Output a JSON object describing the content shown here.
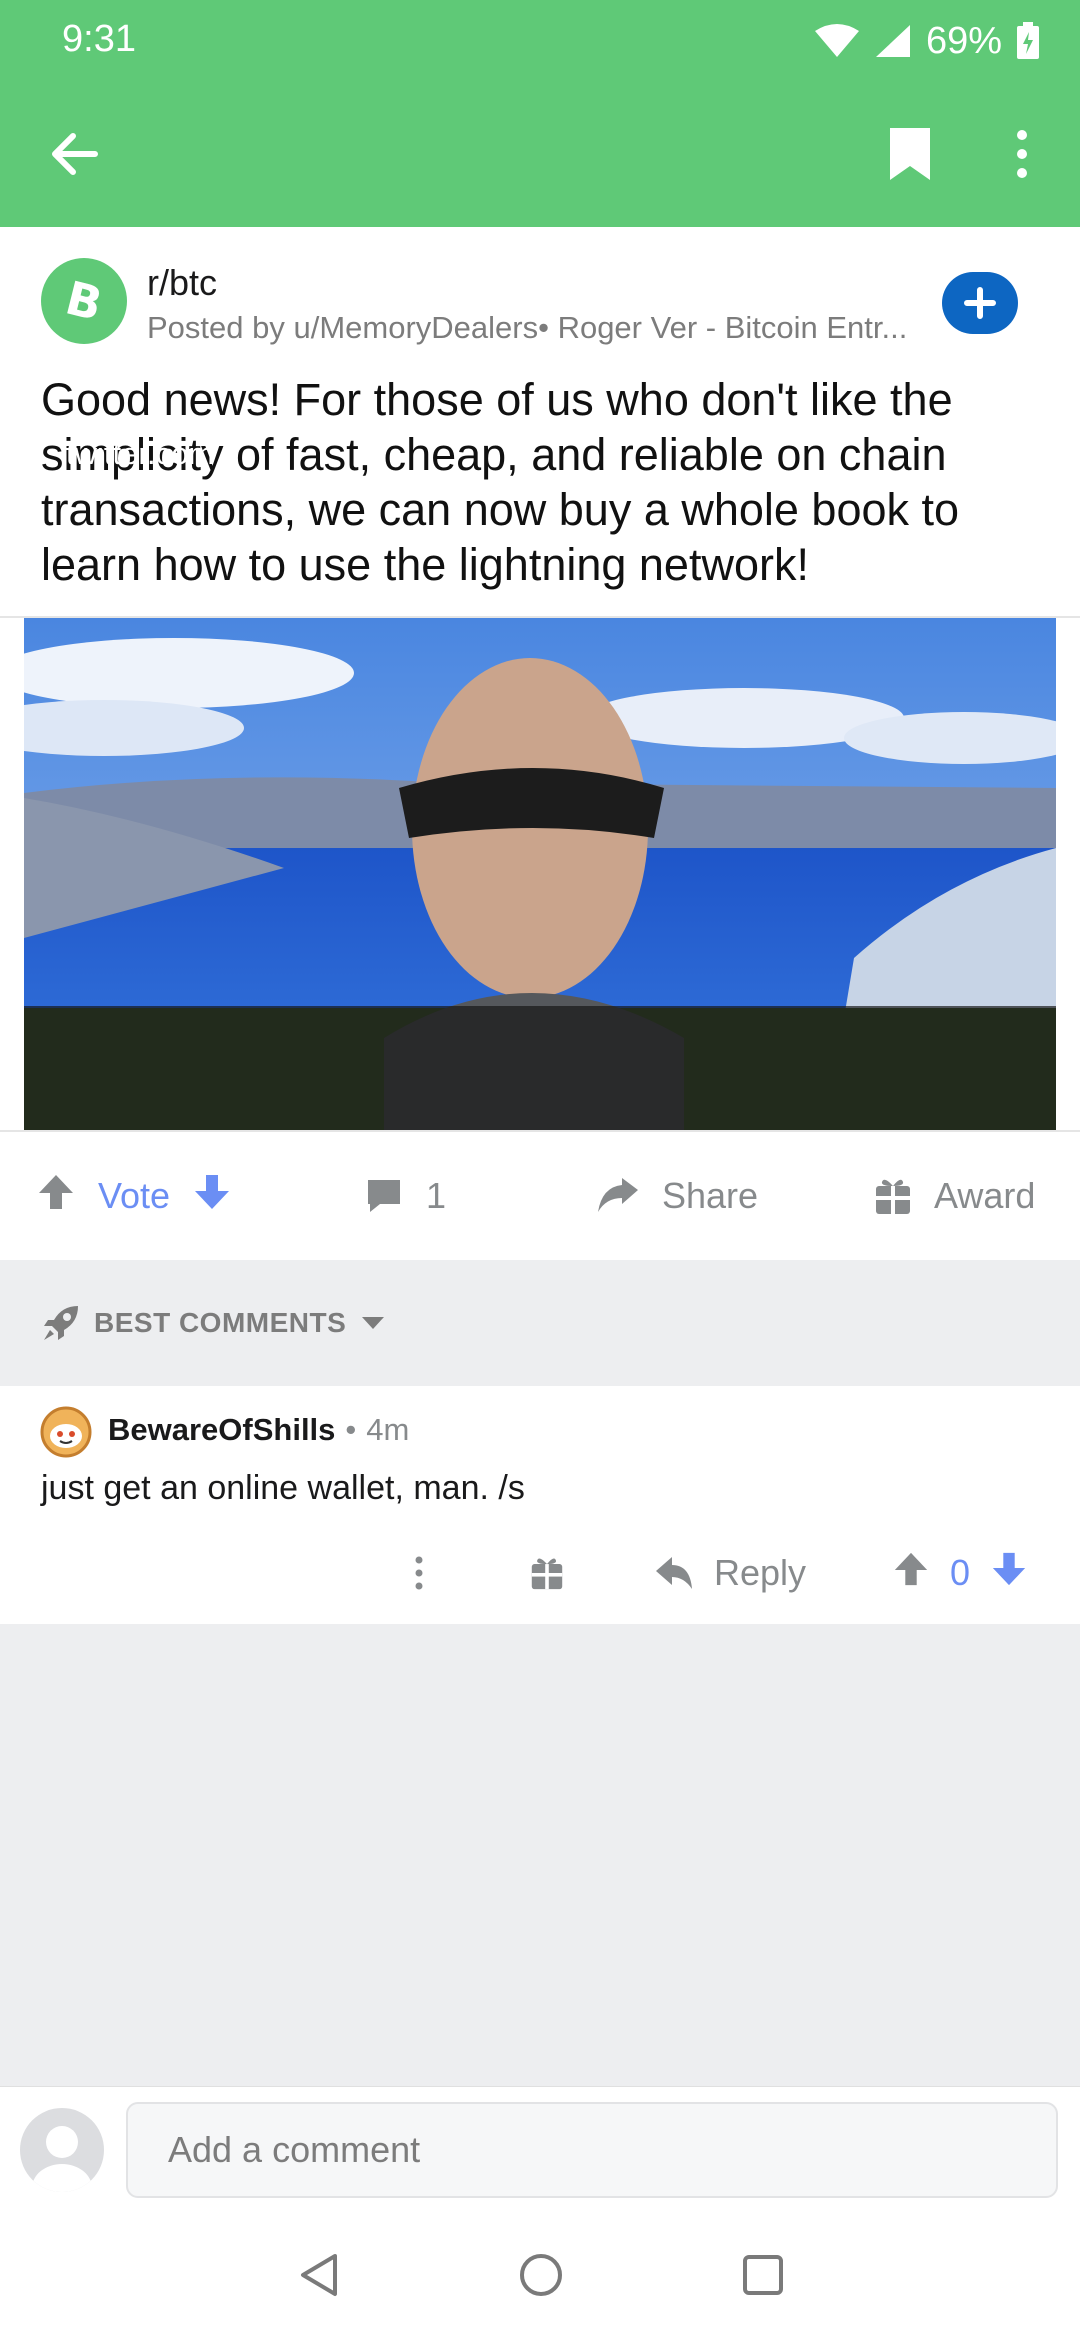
{
  "status_bar": {
    "time": "9:31",
    "battery": "69%"
  },
  "app_bar": {
    "back_icon": "arrow-left-icon",
    "bookmark_icon": "bookmark-icon",
    "more_icon": "more-vertical-icon"
  },
  "post": {
    "subreddit": "r/btc",
    "posted_by": "Posted by u/MemoryDealers• Roger Ver - Bitcoin Entr...",
    "title": "Good news! For those of us who don't like the simplicity of fast, cheap, and reliable on chain transactions, we can now buy a whole book to learn how to use the lightning network!",
    "link_domain": "twitter.com",
    "accent_color": "#5fc977",
    "join_color": "#0d66c2"
  },
  "actions": {
    "vote_label": "Vote",
    "comment_count": "1",
    "share_label": "Share",
    "award_label": "Award"
  },
  "sort": {
    "label": "BEST COMMENTS"
  },
  "comment": {
    "author": "BewareOfShills",
    "separator": "•",
    "age": "4m",
    "body": "just get an online wallet, man. /s",
    "reply_label": "Reply",
    "score": "0"
  },
  "composer": {
    "placeholder": "Add a comment"
  }
}
